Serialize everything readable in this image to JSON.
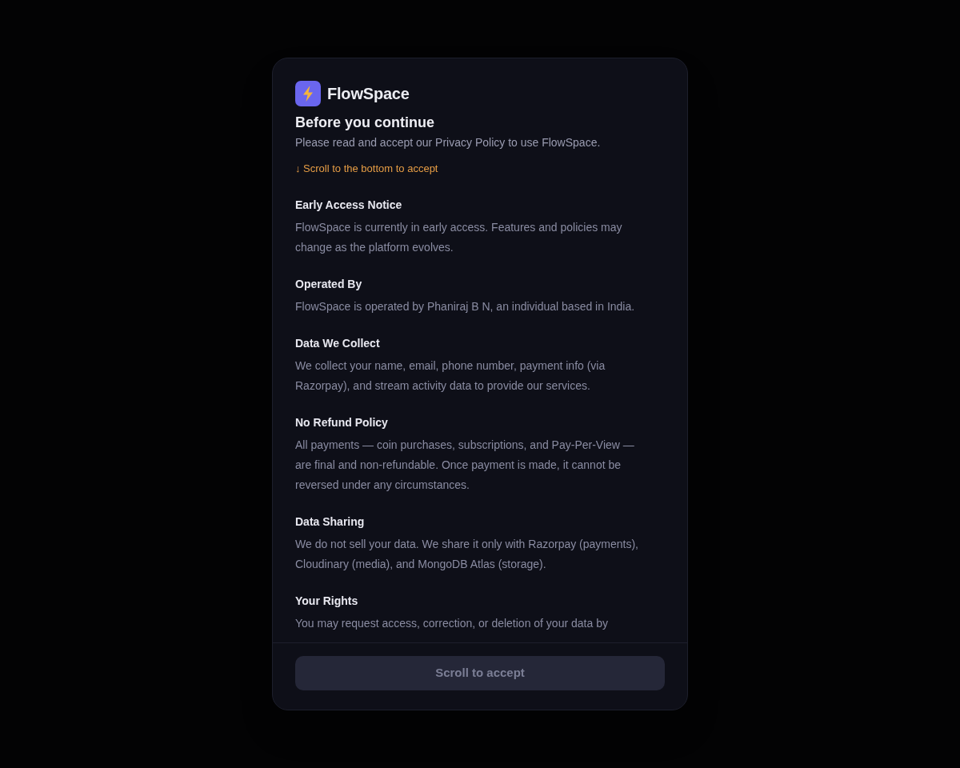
{
  "app": {
    "name": "FlowSpace"
  },
  "dialog": {
    "title": "Before you continue",
    "subtitle": "Please read and accept our Privacy Policy to use FlowSpace.",
    "notice": "↓ Scroll to the bottom to accept"
  },
  "sections": [
    {
      "heading": "Early Access Notice",
      "body": "FlowSpace is currently in early access. Features and policies may change as the platform evolves."
    },
    {
      "heading": "Operated By",
      "body": "FlowSpace is operated by Phaniraj B N, an individual based in India."
    },
    {
      "heading": "Data We Collect",
      "body": "We collect your name, email, phone number, payment info (via Razorpay), and stream activity data to provide our services."
    },
    {
      "heading": "No Refund Policy",
      "body": "All payments — coin purchases, subscriptions, and Pay-Per-View — are final and non-refundable. Once payment is made, it cannot be reversed under any circumstances."
    },
    {
      "heading": "Data Sharing",
      "body": "We do not sell your data. We share it only with Razorpay (payments), Cloudinary (media), and MongoDB Atlas (storage)."
    },
    {
      "heading": "Your Rights",
      "body": "You may request access, correction, or deletion of your data by"
    }
  ],
  "footer_button": {
    "label": "Scroll to accept",
    "disabled": true
  }
}
